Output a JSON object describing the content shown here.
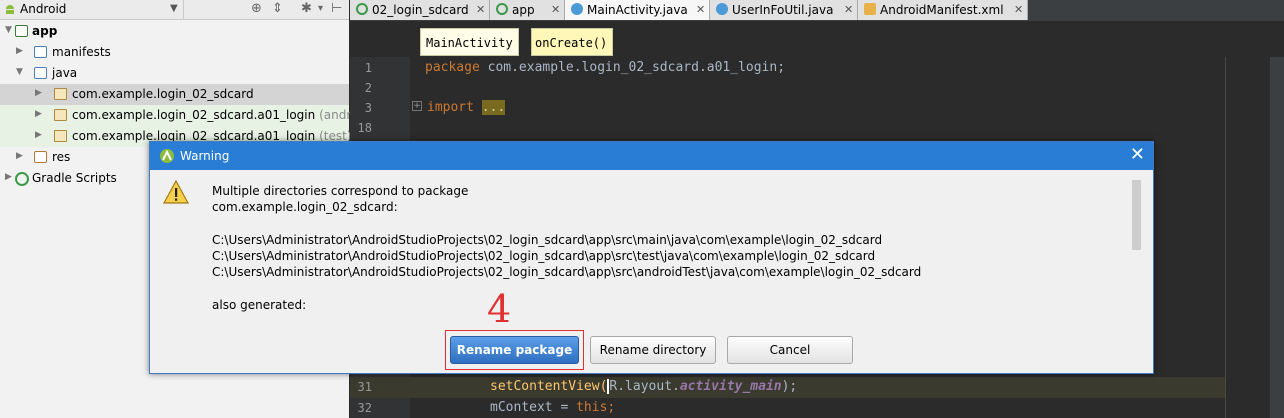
{
  "project_panel": {
    "view_selector": "Android",
    "tree": [
      {
        "label": "app",
        "bold": true
      },
      {
        "label": "manifests"
      },
      {
        "label": "java"
      },
      {
        "label": "com.example.login_02_sdcard"
      },
      {
        "label": "com.example.login_02_sdcard.a01_login",
        "suffix": "(androi"
      },
      {
        "label": "com.example.login_02_sdcard.a01_login",
        "suffix": "(test)"
      },
      {
        "label": "res"
      },
      {
        "label": "Gradle Scripts"
      }
    ]
  },
  "tabs": [
    {
      "label": "02_login_sdcard"
    },
    {
      "label": "app"
    },
    {
      "label": "MainActivity.java"
    },
    {
      "label": "UserInFoUtil.java"
    },
    {
      "label": "AndroidManifest.xml"
    }
  ],
  "breadcrumb": {
    "class_name": "MainActivity",
    "method_name": "onCreate()"
  },
  "editor": {
    "line_numbers": [
      "1",
      "2",
      "3",
      "18",
      "31",
      "32"
    ],
    "package_kw": "package",
    "package_name": "com.example.login_02_sdcard.a01_login;",
    "import_kw": "import",
    "import_fold": "...",
    "line31_method": "setContentView(",
    "line31_r": "R",
    "line31_layout": ".layout.",
    "line31_id": "activity_main",
    "line31_close": ");",
    "line32_var": "mContext = ",
    "line32_this": "this",
    "line32_semi": ";"
  },
  "dialog": {
    "title": "Warning",
    "message": "Multiple directories correspond to package\ncom.example.login_02_sdcard:\n\nC:\\Users\\Administrator\\AndroidStudioProjects\\02_login_sdcard\\app\\src\\main\\java\\com\\example\\login_02_sdcard\nC:\\Users\\Administrator\\AndroidStudioProjects\\02_login_sdcard\\app\\src\\test\\java\\com\\example\\login_02_sdcard\nC:\\Users\\Administrator\\AndroidStudioProjects\\02_login_sdcard\\app\\src\\androidTest\\java\\com\\example\\login_02_sdcard\n\nalso generated:",
    "buttons": {
      "rename_package": "Rename package",
      "rename_directory": "Rename directory",
      "cancel": "Cancel"
    }
  },
  "annotation": {
    "step_number": "4"
  },
  "colors": {
    "dialog_title": "#2a7dd4",
    "primary_button": "#2f6fc0",
    "annotation": "#e03030",
    "editor_bg": "#2b2b2b",
    "keyword": "#cc7832"
  }
}
